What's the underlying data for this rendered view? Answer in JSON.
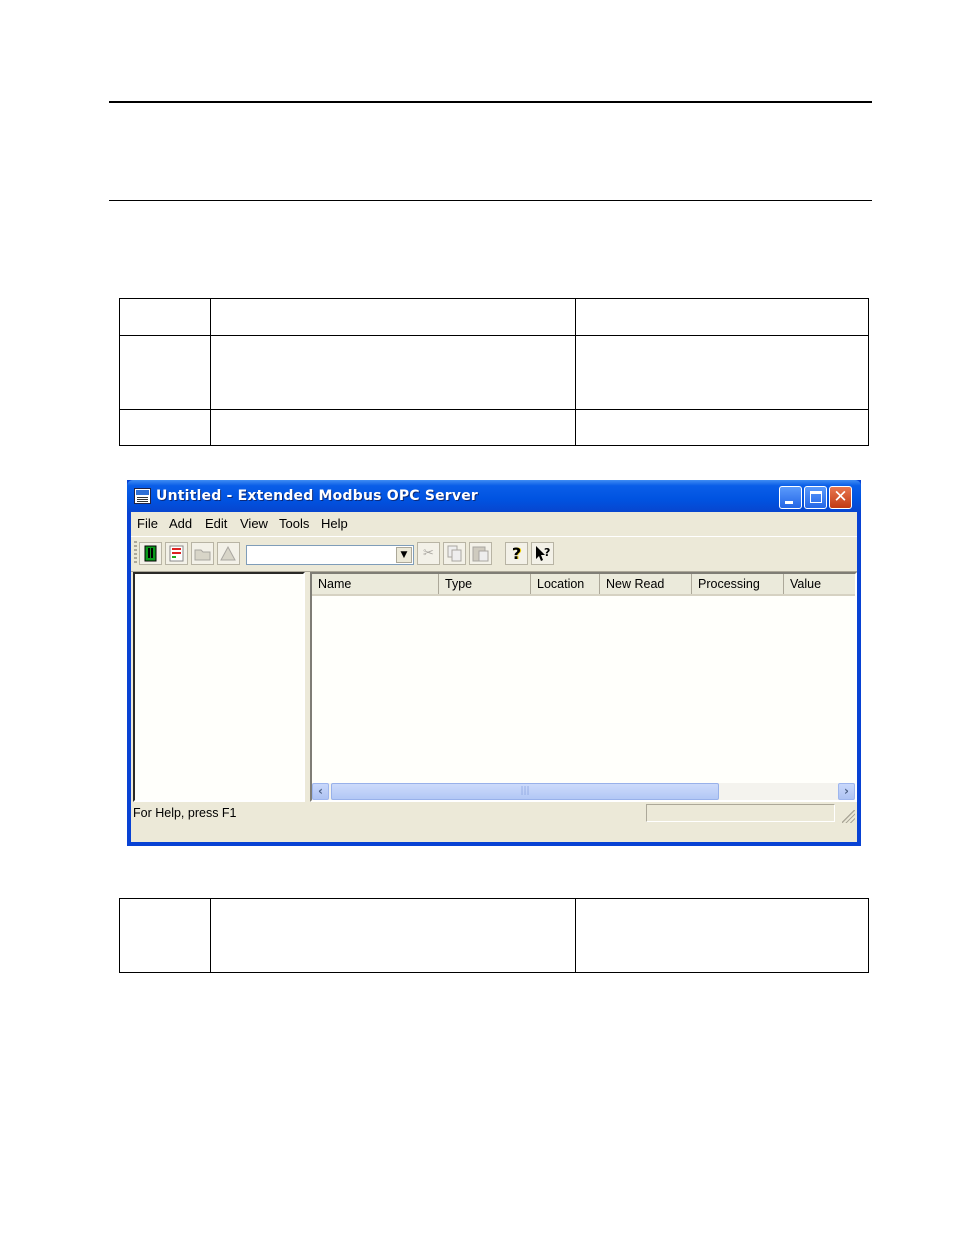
{
  "window": {
    "title": "Untitled - Extended Modbus OPC Server",
    "controls": {
      "minimize_icon": "minimize-icon",
      "maximize_icon": "maximize-icon",
      "close_icon": "close-icon"
    }
  },
  "menu": {
    "items": [
      {
        "label": "File"
      },
      {
        "label": "Add"
      },
      {
        "label": "Edit"
      },
      {
        "label": "View"
      },
      {
        "label": "Tools"
      },
      {
        "label": "Help"
      }
    ]
  },
  "toolbar": {
    "buttons": [
      {
        "icon": "new-channel-icon",
        "enabled": true
      },
      {
        "icon": "new-device-icon",
        "enabled": true
      },
      {
        "icon": "new-group-icon",
        "enabled": false
      },
      {
        "icon": "new-tag-icon",
        "enabled": false
      },
      {
        "icon": "cut-icon",
        "enabled": false
      },
      {
        "icon": "copy-icon",
        "enabled": false
      },
      {
        "icon": "paste-icon",
        "enabled": false
      },
      {
        "icon": "help-icon",
        "enabled": true
      },
      {
        "icon": "context-help-icon",
        "enabled": true
      }
    ],
    "combo_value": ""
  },
  "list": {
    "columns": [
      {
        "label": "Name"
      },
      {
        "label": "Type"
      },
      {
        "label": "Location"
      },
      {
        "label": "New Read"
      },
      {
        "label": "Processing"
      },
      {
        "label": "Value"
      }
    ]
  },
  "status": {
    "text": "For Help, press F1"
  },
  "colors": {
    "titlebar": "#0053e1",
    "client_bg": "#ece9d8",
    "pane_bg": "#fffffb"
  }
}
